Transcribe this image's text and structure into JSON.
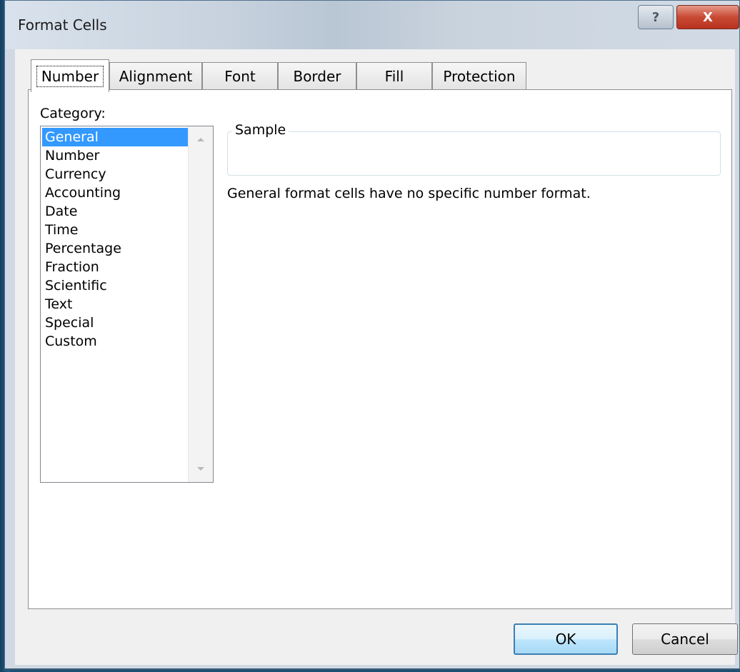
{
  "window": {
    "title": "Format Cells",
    "help_glyph": "?",
    "close_glyph": "X"
  },
  "tabs": [
    {
      "label": "Number",
      "active": true
    },
    {
      "label": "Alignment",
      "active": false
    },
    {
      "label": "Font",
      "active": false
    },
    {
      "label": "Border",
      "active": false
    },
    {
      "label": "Fill",
      "active": false
    },
    {
      "label": "Protection",
      "active": false
    }
  ],
  "category": {
    "label": "Category:",
    "selected": "General",
    "items": [
      "General",
      "Number",
      "Currency",
      "Accounting",
      "Date",
      "Time",
      "Percentage",
      "Fraction",
      "Scientific",
      "Text",
      "Special",
      "Custom"
    ]
  },
  "sample": {
    "legend": "Sample",
    "value": ""
  },
  "description": "General format cells have no specific number format.",
  "buttons": {
    "ok": "OK",
    "cancel": "Cancel"
  },
  "colors": {
    "selection": "#3399ff",
    "close_button": "#c94a34",
    "default_button_border": "#3c7fb1"
  }
}
